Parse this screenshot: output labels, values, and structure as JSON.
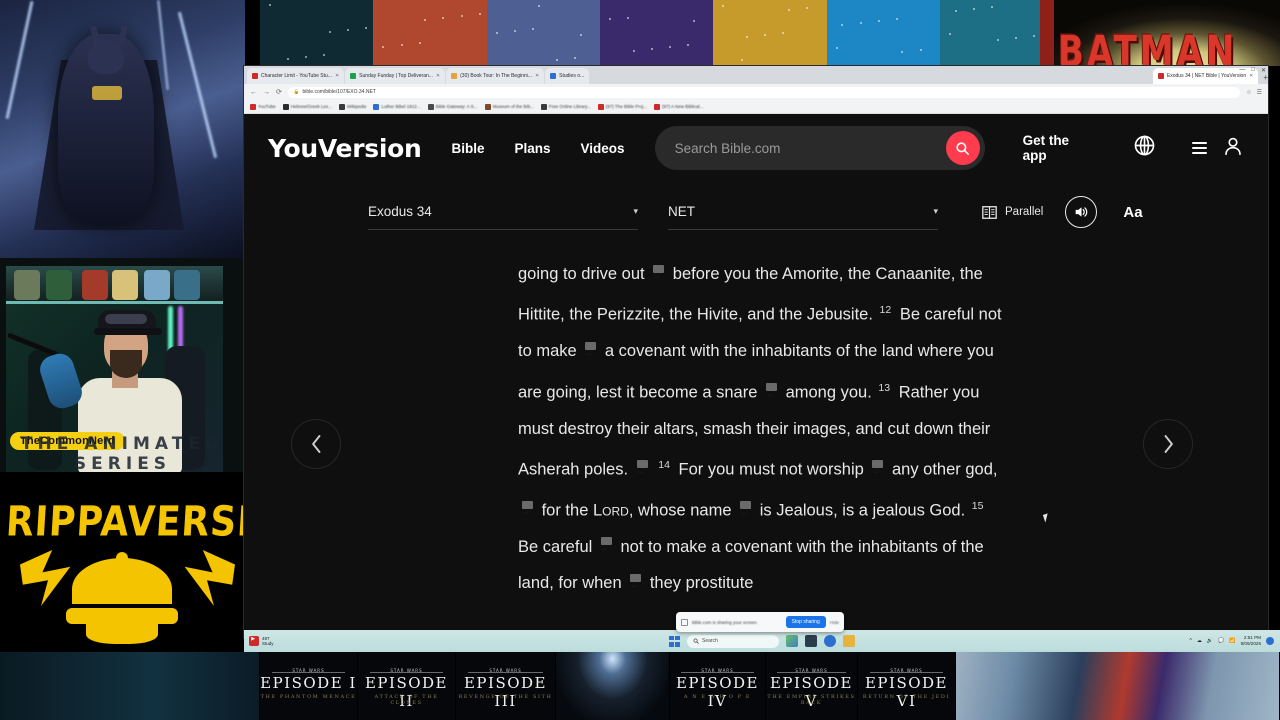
{
  "browser": {
    "tabs": [
      {
        "title": "Character Limit - YouTube Stu...",
        "favicon": "#cf2a2a",
        "active": false
      },
      {
        "title": "Sunday Funday | Top Deliveran...",
        "favicon": "#1aa34a",
        "active": false
      },
      {
        "title": "(30) Book Tour: In The Beginni...",
        "favicon": "#e8a33d",
        "active": false
      },
      {
        "title": "Studies o...",
        "favicon": "#2d6fd0",
        "active": false
      },
      {
        "title": "Exodus 34 | NET Bible | YouVersion",
        "favicon": "#cf2a2a",
        "active": true
      }
    ],
    "new_tab_label": "+",
    "window_buttons": [
      "—",
      "□",
      "✕"
    ],
    "nav": {
      "back": "←",
      "forward": "→",
      "reload": "⟳"
    },
    "url": "bible.com/bible/107/EXO.34.NET",
    "lock_icon": "lock-icon",
    "omnibox_buttons": [
      "☆",
      "☰"
    ],
    "bookmarks": [
      {
        "label": "YouTube",
        "color": "#cf2a2a"
      },
      {
        "label": "Hebrew/Greek Lex...",
        "color": "#2b2b2b"
      },
      {
        "label": "Wikipedia",
        "color": "#3a3a3a"
      },
      {
        "label": "Luther Bibel 1912...",
        "color": "#2d6fd0"
      },
      {
        "label": "Bible Gateway: A S...",
        "color": "#4a4a4a"
      },
      {
        "label": "Museum of the Bib...",
        "color": "#7a4a2a"
      },
      {
        "label": "Free Online Library...",
        "color": "#3a3a3a"
      },
      {
        "label": "(97) The Bible Proj...",
        "color": "#cf2a2a"
      },
      {
        "label": "(97) A New Biblical...",
        "color": "#cf2a2a"
      }
    ],
    "share_notice": {
      "text": "bible.com is sharing your screen.",
      "stop_label": "Stop sharing",
      "hide_label": "Hide"
    }
  },
  "site": {
    "logo": "YouVersion",
    "nav": [
      {
        "label": "Bible"
      },
      {
        "label": "Plans"
      },
      {
        "label": "Videos"
      }
    ],
    "search": {
      "placeholder": "Search Bible.com",
      "value": "",
      "button_icon": "search-icon",
      "accent_color": "#ff3b4e"
    },
    "get_app_label": "Get the app",
    "globe_icon": "globe-icon",
    "menu_icon": "hamburger-icon",
    "account_icon": "account-icon"
  },
  "reader_toolbar": {
    "book_chapter": "Exodus 34",
    "version": "NET",
    "caret": "▾",
    "parallel_label": "Parallel",
    "parallel_icon": "parallel-columns-icon",
    "audio_icon": "speaker-icon",
    "text_size_label": "Aa",
    "prev_icon": "chevron-left-icon",
    "next_icon": "chevron-right-icon"
  },
  "passage": {
    "reference": "Exodus 34",
    "version": "NET",
    "lines": [
      {
        "type": "text",
        "value": "going to drive out"
      },
      {
        "type": "note"
      },
      {
        "type": "text",
        "value": "before you the Amorite, the Canaanite, the Hittite, the Perizzite, the Hivite, and the Jebusite."
      },
      {
        "type": "versenum",
        "value": "12"
      },
      {
        "type": "text",
        "value": "Be careful not to make"
      },
      {
        "type": "note"
      },
      {
        "type": "text",
        "value": "a covenant with the inhabitants of the land where you are going, lest it become a snare"
      },
      {
        "type": "note"
      },
      {
        "type": "text",
        "value": "among you."
      },
      {
        "type": "versenum",
        "value": "13"
      },
      {
        "type": "text",
        "value": "Rather you must destroy their altars, smash their images, and cut down their Asherah poles."
      },
      {
        "type": "note"
      },
      {
        "type": "versenum",
        "value": "14"
      },
      {
        "type": "text",
        "value": "For you must not worship"
      },
      {
        "type": "note"
      },
      {
        "type": "text",
        "value": "any other god,"
      },
      {
        "type": "note"
      },
      {
        "type": "text",
        "value": "for the"
      },
      {
        "type": "smallcap",
        "value": "Lord"
      },
      {
        "type": "text",
        "value": ", whose name"
      },
      {
        "type": "note"
      },
      {
        "type": "text",
        "value": "is Jealous, is a jealous God."
      },
      {
        "type": "versenum",
        "value": "15"
      },
      {
        "type": "text",
        "value": "Be careful"
      },
      {
        "type": "note"
      },
      {
        "type": "text",
        "value": "not to make a covenant with the inhabitants of the land, for when"
      },
      {
        "type": "note"
      },
      {
        "type": "text",
        "value": "they prostitute"
      }
    ]
  },
  "stream_overlay": {
    "streamer_name": "TheCommonNerd",
    "series_caption": "THE ANIMATED SERIES",
    "brand_logo": "RIPPAVERSE",
    "brand_color": "#f5c400",
    "batman_title": "BATMAN",
    "star_wars_episodes": [
      {
        "small": "STAR WARS",
        "title": "EPISODE I",
        "subtitle": "THE PHANTOM MENACE"
      },
      {
        "small": "STAR WARS",
        "title": "EPISODE II",
        "subtitle": "ATTACK OF THE CLONES"
      },
      {
        "small": "STAR WARS",
        "title": "EPISODE III",
        "subtitle": "REVENGE OF THE SITH"
      },
      {
        "small": "STAR WARS",
        "title": "EPISODE IV",
        "subtitle": "A  N E W  H O P E"
      },
      {
        "small": "STAR WARS",
        "title": "EPISODE V",
        "subtitle": "THE EMPIRE STRIKES BACK"
      },
      {
        "small": "STAR WARS",
        "title": "EPISODE VI",
        "subtitle": "RETURN OF THE JEDI"
      }
    ]
  },
  "taskbar": {
    "app_title": "497",
    "app_subtitle": "Study",
    "start_icon": "windows-start-icon",
    "search_placeholder": "Search",
    "search_icon": "search-icon",
    "tray_icons": [
      "^",
      "☁",
      "🔊",
      "💬",
      "📶"
    ],
    "clock_time": "2:51 PM",
    "clock_date": "9/09/2025"
  }
}
